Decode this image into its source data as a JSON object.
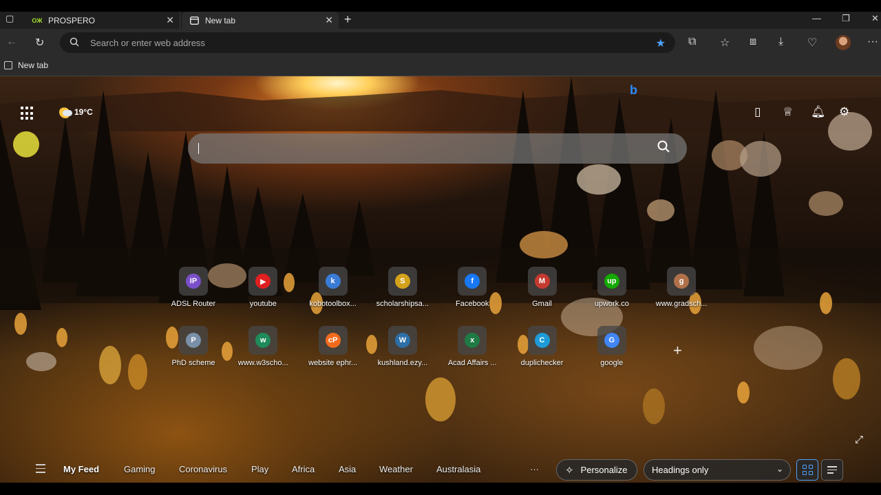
{
  "tabs": [
    {
      "title": "PROSPERO",
      "favicon": "prospero-icon"
    },
    {
      "title": "New tab",
      "favicon": "newtab-icon"
    }
  ],
  "address_bar": {
    "placeholder": "Search or enter web address"
  },
  "favorites_bar": {
    "items": [
      {
        "label": "New tab"
      }
    ]
  },
  "weather": {
    "temp": "19°C"
  },
  "feed_bar": {
    "items": [
      "My Feed",
      "Gaming",
      "Coronavirus",
      "Play",
      "Africa",
      "Asia",
      "Weather",
      "Australasia"
    ],
    "more": "···",
    "personalize": "Personalize",
    "view_select": "Headings only"
  },
  "quick_links": [
    {
      "label": "ADSL Router",
      "glyph": "IP",
      "color": "#7b4fc9"
    },
    {
      "label": "youtube",
      "glyph": "▶",
      "color": "#e02020"
    },
    {
      "label": "kobotoolbox...",
      "glyph": "k",
      "color": "#3a7bd5"
    },
    {
      "label": "scholarshipsa...",
      "glyph": "S",
      "color": "#d3a21a"
    },
    {
      "label": "Facebook",
      "glyph": "f",
      "color": "#1877f2"
    },
    {
      "label": "Gmail",
      "glyph": "M",
      "color": "#c43a2f"
    },
    {
      "label": "upwork.co",
      "glyph": "up",
      "color": "#14a800"
    },
    {
      "label": "www.gradsch...",
      "glyph": "g",
      "color": "#b0714a"
    },
    {
      "label": "PhD scheme",
      "glyph": "P",
      "color": "#7a8fa8"
    },
    {
      "label": "www.w3scho...",
      "glyph": "w",
      "color": "#1f8a5a"
    },
    {
      "label": "website ephr...",
      "glyph": "cP",
      "color": "#f26b1d"
    },
    {
      "label": "kushland.ezy...",
      "glyph": "W",
      "color": "#2d6fa6"
    },
    {
      "label": "Acad Affairs ...",
      "glyph": "x",
      "color": "#1f7a44"
    },
    {
      "label": "duplichecker",
      "glyph": "C",
      "color": "#1e9bd7"
    },
    {
      "label": "google",
      "glyph": "G",
      "color": "#4285f4"
    }
  ],
  "colors": {
    "accent": "#4ca3ff",
    "bing": "#2a8cff"
  }
}
